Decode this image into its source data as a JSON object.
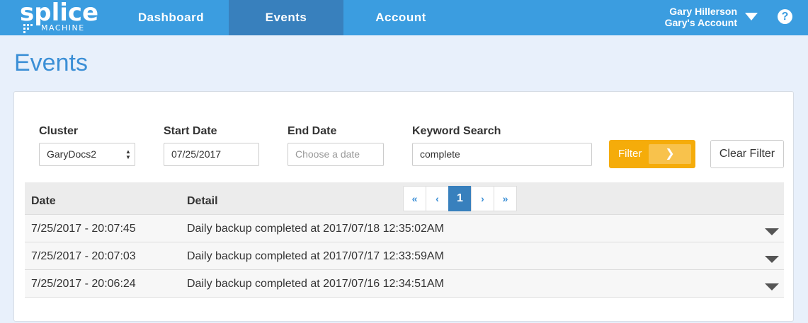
{
  "brand": {
    "name": "splice",
    "sub": "MACHINE"
  },
  "nav": {
    "items": [
      {
        "label": "Dashboard"
      },
      {
        "label": "Events"
      },
      {
        "label": "Account"
      }
    ]
  },
  "user": {
    "name": "Gary Hillerson",
    "account": "Gary's Account"
  },
  "help": {
    "glyph": "?"
  },
  "page": {
    "title": "Events"
  },
  "filters": {
    "cluster": {
      "label": "Cluster",
      "value": "GaryDocs2"
    },
    "start_date": {
      "label": "Start Date",
      "value": "07/25/2017"
    },
    "end_date": {
      "label": "End Date",
      "placeholder": "Choose a date"
    },
    "keyword": {
      "label": "Keyword Search",
      "value": "complete"
    },
    "filter_button": "Filter",
    "clear_button": "Clear Filter"
  },
  "table": {
    "headers": {
      "date": "Date",
      "detail": "Detail"
    },
    "pagination": {
      "first": "«",
      "prev": "‹",
      "current": "1",
      "next": "›",
      "last": "»"
    },
    "rows": [
      {
        "date": "7/25/2017 - 20:07:45",
        "detail": "Daily backup completed at 2017/07/18 12:35:02AM"
      },
      {
        "date": "7/25/2017 - 20:07:03",
        "detail": "Daily backup completed at 2017/07/17 12:33:59AM"
      },
      {
        "date": "7/25/2017 - 20:06:24",
        "detail": "Daily backup completed at 2017/07/16 12:34:51AM"
      }
    ]
  },
  "colors": {
    "nav_bg": "#3b9de0",
    "nav_active": "#3880bd",
    "accent": "#f5ac0a",
    "title": "#3b8fd6"
  }
}
